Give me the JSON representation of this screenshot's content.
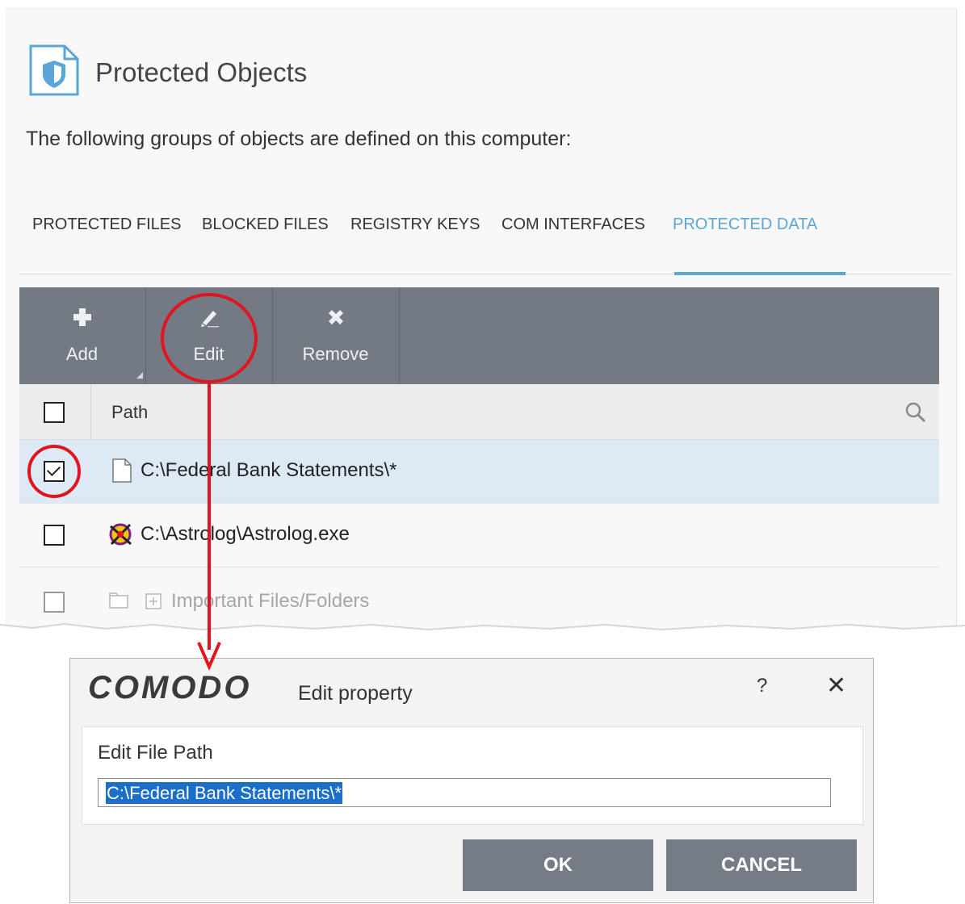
{
  "panel": {
    "title": "Protected Objects",
    "subtitle": "The following groups of objects are defined on this computer:",
    "icon": "shield-document-icon"
  },
  "tabs": [
    {
      "label": "PROTECTED FILES",
      "active": false
    },
    {
      "label": "BLOCKED FILES",
      "active": false
    },
    {
      "label": "REGISTRY KEYS",
      "active": false
    },
    {
      "label": "COM INTERFACES",
      "active": false
    },
    {
      "label": "PROTECTED DATA",
      "active": true
    }
  ],
  "toolbar": {
    "add_label": "Add",
    "edit_label": "Edit",
    "remove_label": "Remove"
  },
  "table": {
    "column_path": "Path",
    "rows": [
      {
        "path": "C:\\Federal Bank Statements\\*",
        "checked": true,
        "selected": true,
        "icon": "file-icon"
      },
      {
        "path": "C:\\Astrolog\\Astrolog.exe",
        "checked": false,
        "selected": false,
        "icon": "astrolog-app-icon"
      },
      {
        "path": "Important Files/Folders",
        "checked": false,
        "selected": false,
        "icon": "folder-group-icon"
      }
    ]
  },
  "dialog": {
    "logo": "COMODO",
    "title": "Edit property",
    "help": "?",
    "close": "✕",
    "field_label": "Edit File Path",
    "field_value": "C:\\Federal Bank Statements\\*",
    "ok_label": "OK",
    "cancel_label": "CANCEL"
  },
  "colors": {
    "accent": "#5aa6d6",
    "toolbar": "#737a84",
    "selection_row": "#dde9f5",
    "annotation": "#e0151d",
    "text_highlight": "#1b6fc8"
  }
}
